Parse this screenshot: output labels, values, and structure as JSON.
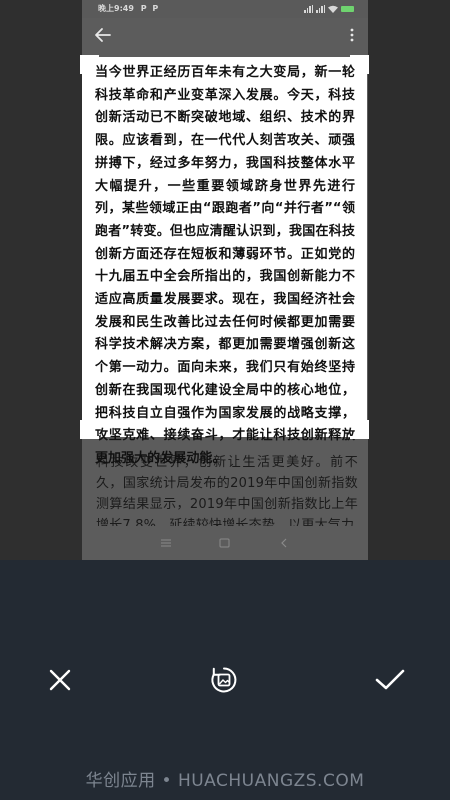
{
  "status_bar": {
    "time": "晚上9:49",
    "app_icons": [
      "P",
      "P"
    ]
  },
  "captured_app": {
    "back_icon": "arrow-left-icon",
    "more_icon": "more-vertical-icon"
  },
  "selected_text": "当今世界正经历百年未有之大变局，新一轮科技革命和产业变革深入发展。今天，科技创新活动已不断突破地域、组织、技术的界限。应该看到，在一代代人刻苦攻关、顽强拼搏下，经过多年努力，我国科技整体水平大幅提升，一些重要领域跻身世界先进行列，某些领域正由“跟跑者”向“并行者”“领跑者”转变。但也应清醒认识到，我国在科技创新方面还存在短板和薄弱环节。正如党的十九届五中全会所指出的，我国创新能力不适应高质量发展要求。现在，我国经济社会发展和民生改善比过去任何时候都更加需要科学技术解决方案，都更加需要增强创新这个第一动力。面向未来，我们只有始终坚持创新在我国现代化建设全局中的核心地位，把科技自立自强作为国家发展的战略支撑，攻坚克难、接续奋斗，才能让科技创新释放更加强大的发展动能。",
  "background_text": "科技改变世界，创新让生活更美好。前不久，国家统计局发布的2019年中国创新指数测算结果显示，2019年中国创新指数比上年增长7.8%，延续较快增长态势，以更大气力",
  "toolbar": {
    "cancel_icon": "close-icon",
    "rotate_icon": "rotate-image-icon",
    "confirm_icon": "checkmark-icon"
  },
  "watermark": "华创应用 • HUACHUANGZS.COM",
  "colors": {
    "toolbar_bg": "#232a33",
    "crop_bg": "#ffffff",
    "dim_overlay": "#5c5c5c"
  }
}
